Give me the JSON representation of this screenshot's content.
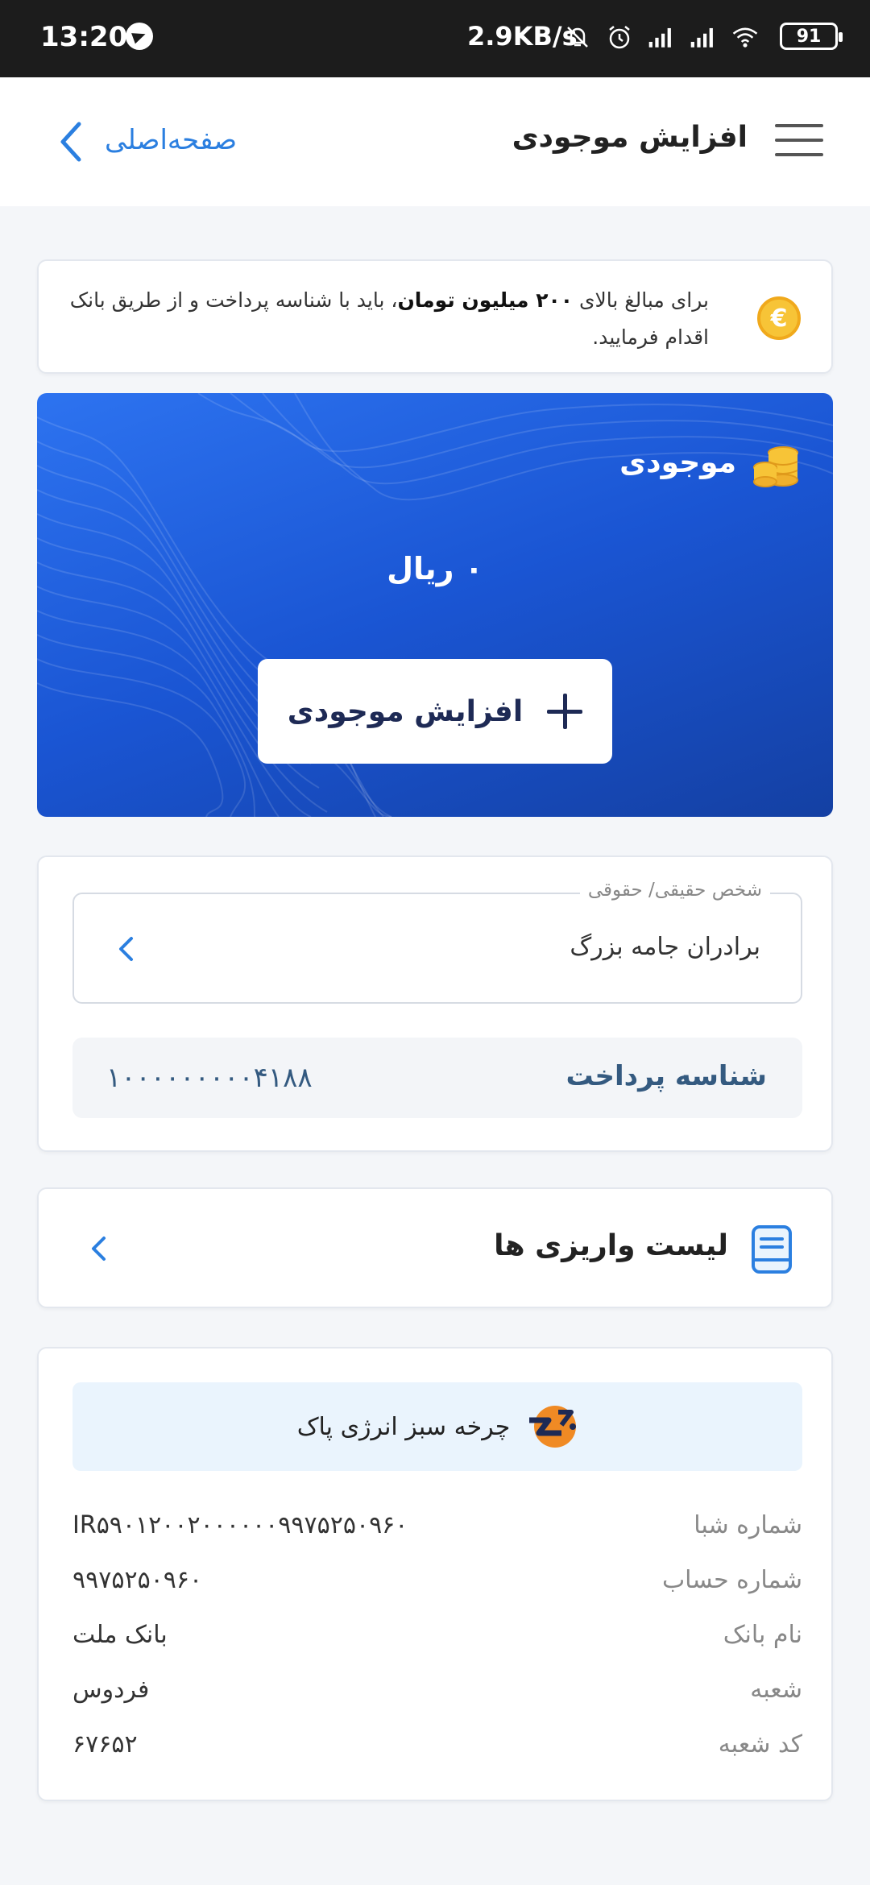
{
  "status_bar": {
    "time": "13:20",
    "speed": "2.9KB/s",
    "battery": "91"
  },
  "header": {
    "title": "افزایش موجودی",
    "home_link": "صفحه‌اصلی"
  },
  "notice": {
    "text_before": "برای مبالغ بالای ",
    "amount": "۲۰۰ میلیون تومان",
    "text_after": "، باید با شناسه پرداخت و از طریق بانک اقدام فرمایید."
  },
  "balance": {
    "label": "موجودی",
    "value": "۰ ریال",
    "button_label": "افزایش موجودی"
  },
  "person": {
    "field_label": "شخص حقیقی/ حقوقی",
    "field_value": "برادران جامه بزرگ",
    "payment_id_label": "شناسه پرداخت",
    "payment_id_value": "۱۰۰۰۰۰۰۰۰۰۴۱۸۸"
  },
  "deposits": {
    "label": "لیست واریزی ها"
  },
  "bank": {
    "company": "چرخه سبز انرژی پاک",
    "rows": [
      {
        "key": "شماره شبا",
        "value": "IR۵۹۰۱۲۰۰۲۰۰۰۰۰۰۹۹۷۵۲۵۰۹۶۰"
      },
      {
        "key": "شماره حساب",
        "value": "۹۹۷۵۲۵۰۹۶۰"
      },
      {
        "key": "نام بانک",
        "value": "بانک ملت"
      },
      {
        "key": "شعبه",
        "value": "فردوس"
      },
      {
        "key": "کد شعبه",
        "value": "۶۷۶۵۲"
      }
    ]
  },
  "colors": {
    "accent": "#2b7fe0",
    "card_gradient_start": "#2d73f0",
    "card_gradient_end": "#1440a3",
    "coin": "#f7c437"
  }
}
